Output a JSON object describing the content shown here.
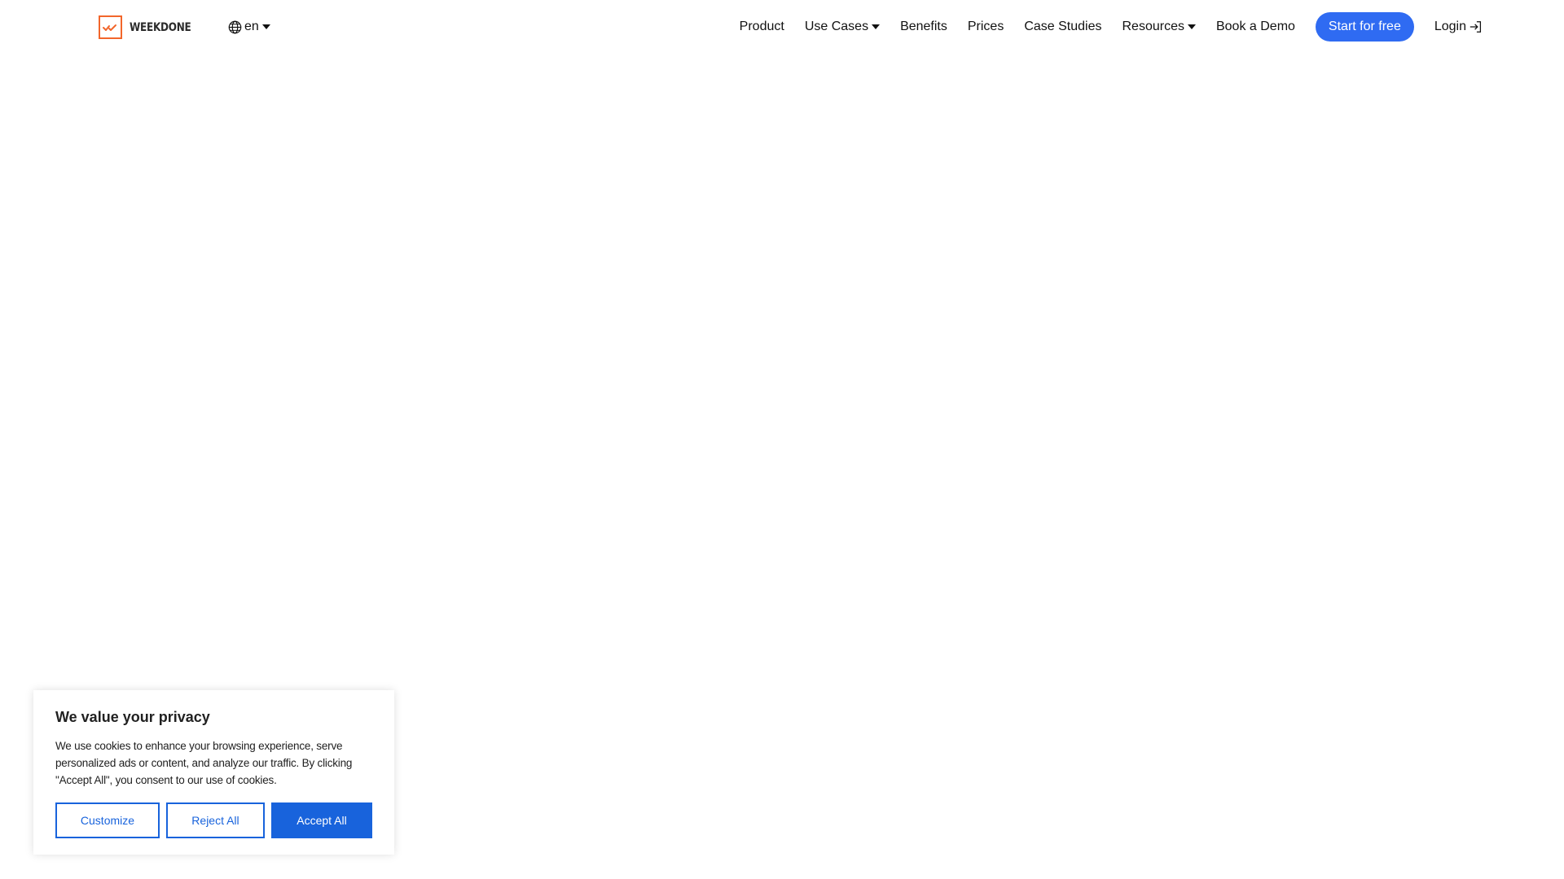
{
  "header": {
    "logo_text": "WEEKDONE",
    "language": "en",
    "nav": {
      "product": "Product",
      "use_cases": "Use Cases",
      "benefits": "Benefits",
      "prices": "Prices",
      "case_studies": "Case Studies",
      "resources": "Resources",
      "book_demo": "Book a Demo",
      "start_free": "Start for free",
      "login": "Login"
    }
  },
  "cookie_banner": {
    "title": "We value your privacy",
    "text": "We use cookies to enhance your browsing experience, serve personalized ads or content, and analyze our traffic. By clicking \"Accept All\", you consent to our use of cookies.",
    "customize_label": "Customize",
    "reject_label": "Reject All",
    "accept_label": "Accept All"
  },
  "colors": {
    "brand_orange": "#f2662b",
    "cta_blue": "#2f6bf2",
    "cookie_blue": "#1863dc"
  },
  "icons": {
    "logo": "checkmark-logo-icon",
    "language": "globe-icon",
    "dropdown": "caret-down-icon",
    "login": "login-arrow-icon"
  }
}
